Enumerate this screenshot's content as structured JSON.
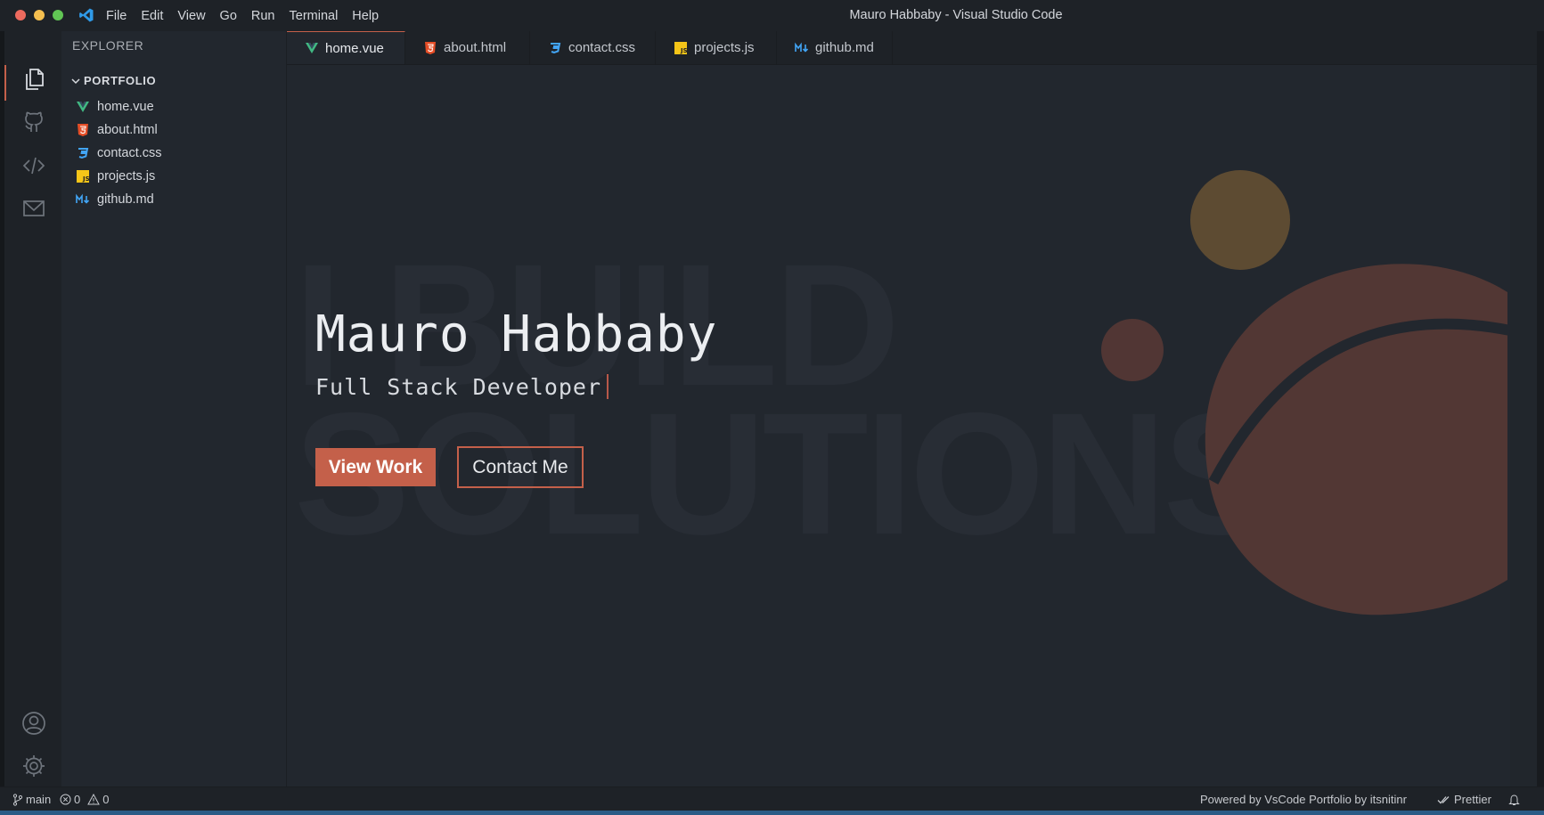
{
  "window": {
    "title": "Mauro Habbaby - Visual Studio Code",
    "traffic_lights": {
      "close": "#ed6a5e",
      "minimize": "#f5bf4f",
      "maximize": "#61c554"
    }
  },
  "menu": [
    "File",
    "Edit",
    "View",
    "Go",
    "Run",
    "Terminal",
    "Help"
  ],
  "activity_bar": {
    "top": [
      "files-icon",
      "github-icon",
      "code-icon",
      "mail-icon"
    ],
    "bottom": [
      "account-icon",
      "settings-gear-icon"
    ]
  },
  "explorer": {
    "title": "EXPLORER",
    "folder": "PORTFOLIO",
    "files": [
      {
        "name": "home.vue",
        "icon": "vue-icon"
      },
      {
        "name": "about.html",
        "icon": "html-icon"
      },
      {
        "name": "contact.css",
        "icon": "css-icon"
      },
      {
        "name": "projects.js",
        "icon": "js-icon"
      },
      {
        "name": "github.md",
        "icon": "markdown-icon"
      }
    ]
  },
  "tabs": [
    {
      "label": "home.vue",
      "icon": "vue-icon",
      "active": true
    },
    {
      "label": "about.html",
      "icon": "html-icon",
      "active": false
    },
    {
      "label": "contact.css",
      "icon": "css-icon",
      "active": false
    },
    {
      "label": "projects.js",
      "icon": "js-icon",
      "active": false
    },
    {
      "label": "github.md",
      "icon": "markdown-icon",
      "active": false
    }
  ],
  "hero": {
    "name": "Mauro Habbaby",
    "role": "Full Stack Developer",
    "watermark_line1": "I BUILD",
    "watermark_line2": "SOLUTIONS",
    "primary_button": "View Work",
    "secondary_button": "Contact Me"
  },
  "statusbar": {
    "branch": "main",
    "errors": "0",
    "warnings": "0",
    "credit": "Powered by VsCode Portfolio by itsnitinr",
    "formatter": "Prettier"
  },
  "colors": {
    "accent": "#c4604a",
    "vue": "#41b883",
    "html": "#e44d26",
    "css": "#42a5f5",
    "js": "#f5c518",
    "markdown": "#42a5f5"
  }
}
